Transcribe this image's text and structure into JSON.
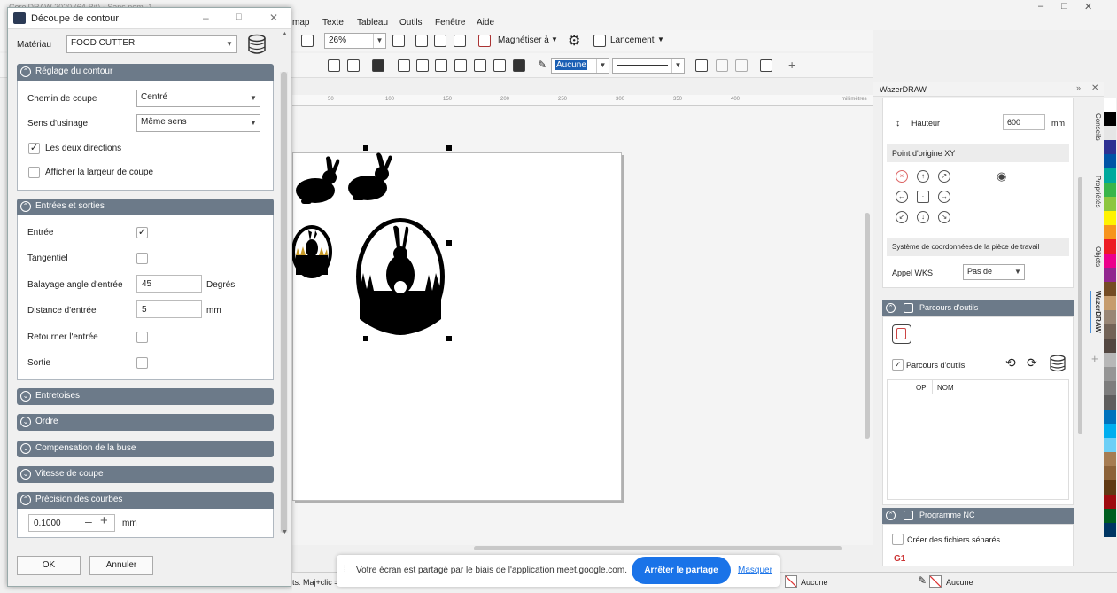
{
  "app": {
    "title": "CorelDRAW 2020 (64-Bit) - Sans nom -1",
    "menu": [
      "map",
      "Texte",
      "Tableau",
      "Outils",
      "Fenêtre",
      "Aide"
    ],
    "zoom": "26%",
    "snap_label": "Magnétiser à",
    "launch_label": "Lancement",
    "outline_value": "Aucune",
    "ruler_unit": "millimètres",
    "ruler_ticks": [
      "50",
      "100",
      "150",
      "200",
      "250",
      "300",
      "350",
      "400"
    ]
  },
  "dialog": {
    "title": "Découpe de contour",
    "material_label": "Matériau",
    "material_value": "FOOD CUTTER",
    "sections": {
      "contour": {
        "title": "Réglage du contour",
        "cut_path_label": "Chemin de coupe",
        "cut_path_value": "Centré",
        "direction_label": "Sens d'usinage",
        "direction_value": "Même sens",
        "both_dirs_label": "Les deux directions",
        "both_dirs_checked": true,
        "show_width_label": "Afficher la largeur de coupe",
        "show_width_checked": false
      },
      "io": {
        "title": "Entrées et sorties",
        "entry_label": "Entrée",
        "entry_checked": true,
        "tangential_label": "Tangentiel",
        "sweep_label": "Balayage angle d'entrée",
        "sweep_value": "45",
        "sweep_unit": "Degrés",
        "distance_label": "Distance d'entrée",
        "distance_value": "5",
        "distance_unit": "mm",
        "reverse_label": "Retourner l'entrée",
        "exit_label": "Sortie"
      },
      "collapsed": [
        "Entretoises",
        "Ordre",
        "Compensation de la buse",
        "Vitesse de coupe"
      ],
      "precision": {
        "title": "Précision des courbes",
        "value": "0.1000",
        "unit": "mm"
      }
    },
    "ok_label": "OK",
    "cancel_label": "Annuler"
  },
  "panel": {
    "title": "WazerDRAW",
    "height_label": "Hauteur",
    "height_value": "600",
    "height_unit": "mm",
    "origin_label": "Point d'origine XY",
    "wcs_label": "Système de coordonnées de la pièce de travail",
    "wks_label": "Appel WKS",
    "wks_value": "Pas de",
    "toolpaths_title": "Parcours d'outils",
    "toolpaths_check_label": "Parcours d'outils",
    "col_op": "OP",
    "col_nom": "NOM",
    "nc_title": "Programme NC",
    "separate_files_label": "Créer des fichiers séparés",
    "g1": "G1",
    "vtabs": [
      "Conseils",
      "Propriétés",
      "Objets",
      "WazerDRAW"
    ]
  },
  "share": {
    "message": "Votre écran est partagé par le biais de l'application meet.google.com.",
    "stop_label": "Arrêter le partage",
    "hide_label": "Masquer"
  },
  "status": {
    "left": "ts: Maj+clic =",
    "fill": "Aucune",
    "outline": "Aucune"
  },
  "colors": {
    "section": "#6c7a89",
    "share_button": "#1a73e8",
    "palette": [
      "#ffffff",
      "#000000",
      "#e6e6e6",
      "#2e3192",
      "#0054a6",
      "#00a99d",
      "#39b54a",
      "#8dc63f",
      "#fff200",
      "#f7941d",
      "#ed1c24",
      "#ec008c",
      "#92278f",
      "#754c24",
      "#c69c6d",
      "#998675",
      "#736357",
      "#534741",
      "#b7b7b7",
      "#959595",
      "#7d7d7d",
      "#5e5e5e",
      "#0072bc",
      "#00aeef",
      "#6dcff6",
      "#a67c52",
      "#8c6239",
      "#603913",
      "#9e0b0f",
      "#005e20",
      "#003663"
    ]
  }
}
